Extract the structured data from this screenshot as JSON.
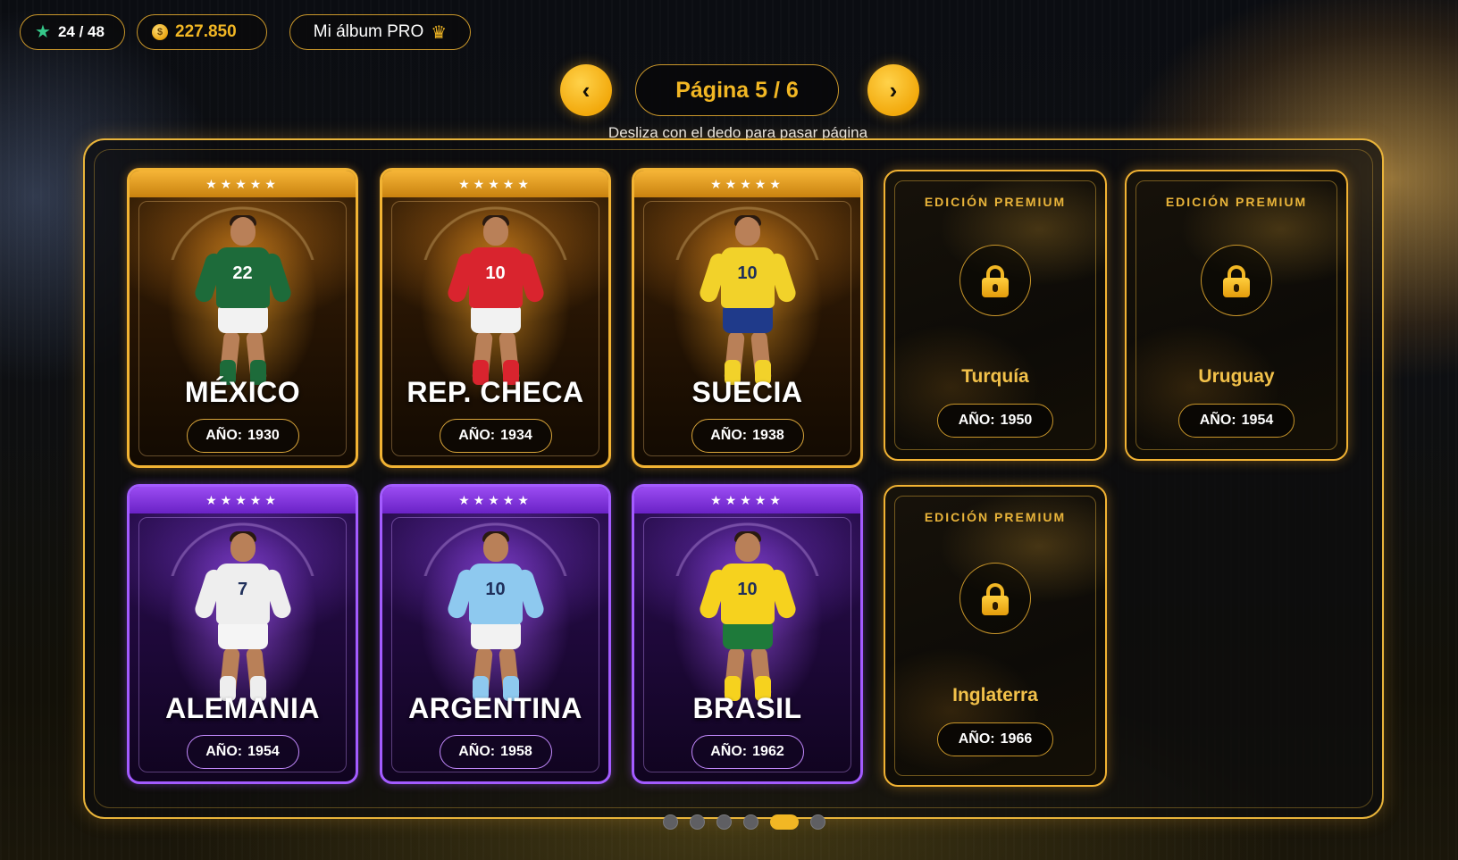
{
  "header": {
    "progress": "24 / 48",
    "coins": "227.850",
    "album_button": "Mi álbum PRO",
    "icons": {
      "progress": "star-icon",
      "coins": "coin-icon",
      "album": "crown-icon"
    }
  },
  "pager": {
    "prev_label": "‹",
    "next_label": "›",
    "page_label": "Página 5 / 6",
    "hint": "Desliza con el dedo para pasar página",
    "current_page": 5,
    "total_pages": 6
  },
  "cards": [
    {
      "type": "gold",
      "stars": "★★★★★",
      "country": "MÉXICO",
      "year_label": "AÑO:",
      "year": "1930",
      "jersey": "#1d6b3a",
      "shorts": "#f2f2f2",
      "number": "22"
    },
    {
      "type": "gold",
      "stars": "★★★★★",
      "country": "REP. CHECA",
      "year_label": "AÑO:",
      "year": "1934",
      "jersey": "#d9242e",
      "shorts": "#f2f2f2",
      "number": "10"
    },
    {
      "type": "gold",
      "stars": "★★★★★",
      "country": "SUECIA",
      "year_label": "AÑO:",
      "year": "1938",
      "jersey": "#f2d22a",
      "shorts": "#1f3a8a",
      "number": "10"
    },
    {
      "type": "purple",
      "stars": "★★★★★",
      "country": "ALEMANIA",
      "year_label": "AÑO:",
      "year": "1954",
      "jersey": "#eeeeee",
      "shorts": "#f5f5f5",
      "number": "7"
    },
    {
      "type": "purple",
      "stars": "★★★★★",
      "country": "ARGENTINA",
      "year_label": "AÑO:",
      "year": "1958",
      "jersey": "#8ec9ef",
      "shorts": "#f2f2f2",
      "number": "10"
    },
    {
      "type": "purple",
      "stars": "★★★★★",
      "country": "BRASIL",
      "year_label": "AÑO:",
      "year": "1962",
      "jersey": "#f6d21e",
      "shorts": "#1e7a3a",
      "number": "10"
    }
  ],
  "locked": [
    {
      "badge": "EDICIÓN PREMIUM",
      "country": "Turquía",
      "year_label": "AÑO:",
      "year": "1950"
    },
    {
      "badge": "EDICIÓN PREMIUM",
      "country": "Uruguay",
      "year_label": "AÑO:",
      "year": "1954"
    },
    {
      "badge": "EDICIÓN PREMIUM",
      "country": "Inglaterra",
      "year_label": "AÑO:",
      "year": "1966"
    }
  ],
  "colors": {
    "accent": "#f2b724",
    "gold_frame": "#e9b43a",
    "purple_frame": "#a35bff"
  }
}
